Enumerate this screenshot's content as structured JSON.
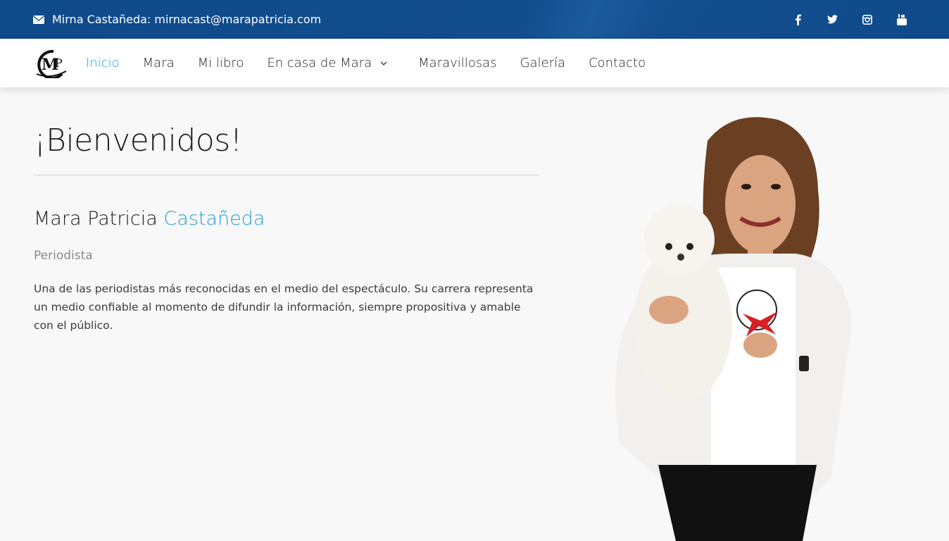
{
  "topbar": {
    "contact_text": "Mirna Castañeda: mirnacast@marapatricia.com",
    "icons": [
      "mail-icon",
      "facebook-icon",
      "twitter-icon",
      "instagram-icon",
      "youtube-icon"
    ]
  },
  "nav": {
    "logo_text": "MP",
    "items": [
      {
        "label": "Inicio",
        "active": true
      },
      {
        "label": "Mara"
      },
      {
        "label": "Mi libro"
      },
      {
        "label": "En casa de Mara",
        "dropdown": true
      },
      {
        "label": "Maravillosas"
      },
      {
        "label": "Galería"
      },
      {
        "label": "Contacto"
      }
    ]
  },
  "hero": {
    "title": "¡Bienvenidos!",
    "name_first": "Mara Patricia",
    "name_last": "Castañeda",
    "role": "Periodista",
    "bio": "Una de las periodistas más reconocidas en el medio del espectáculo. Su carrera representa un medio confiable al momento de difundir la información, siempre propositiva y amable con el público."
  },
  "colors": {
    "topbar": "#124d8d",
    "accent": "#2a9fd6",
    "background": "#f8f8f8"
  }
}
